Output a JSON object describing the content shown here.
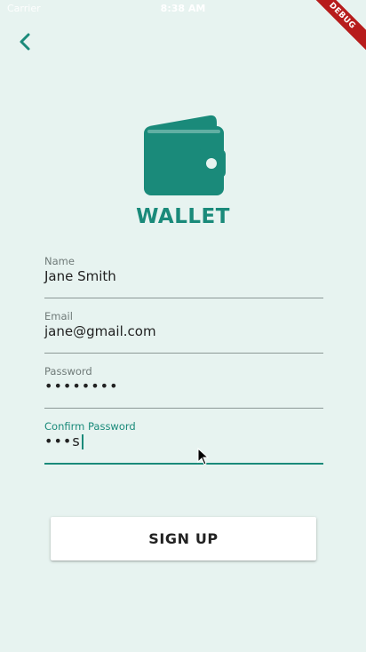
{
  "status_bar": {
    "carrier": "Carrier",
    "time": "8:38 AM"
  },
  "debug_banner": "DEBUG",
  "header": {
    "back_icon": "chevron-left-icon"
  },
  "logo": {
    "icon": "wallet-icon",
    "title": "WALLET"
  },
  "form": {
    "name": {
      "label": "Name",
      "value": "Jane Smith"
    },
    "email": {
      "label": "Email",
      "value": "jane@gmail.com"
    },
    "password": {
      "label": "Password",
      "value": "••••••••"
    },
    "confirm_password": {
      "label": "Confirm Password",
      "value": "•••s"
    }
  },
  "signup_button": {
    "label": "SIGN UP"
  },
  "colors": {
    "accent": "#1a8a7a",
    "background": "#e7f3f0",
    "debug_banner": "#b71c1c"
  }
}
